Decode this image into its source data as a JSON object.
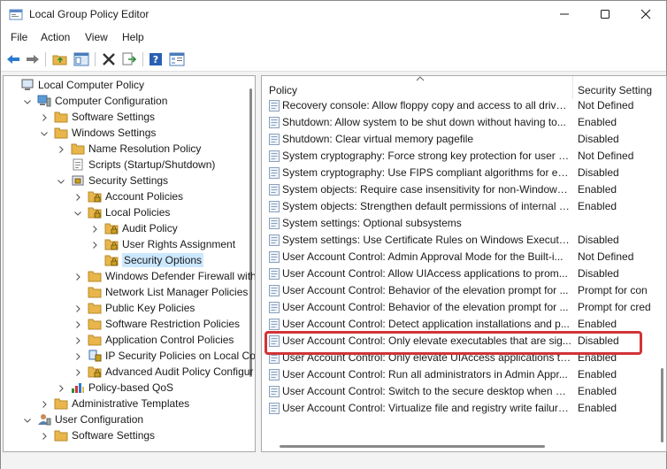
{
  "window": {
    "title": "Local Group Policy Editor"
  },
  "menu": [
    "File",
    "Action",
    "View",
    "Help"
  ],
  "toolbar": {
    "icons": [
      "back-arrow-icon",
      "forward-arrow-icon",
      "up-folder-icon",
      "show-hide-tree-icon",
      "delete-icon",
      "export-list-icon",
      "help-icon",
      "properties-icon"
    ]
  },
  "tree": [
    {
      "label": "Local Computer Policy",
      "indent": 0,
      "chevron": "",
      "icon": "computer-icon"
    },
    {
      "label": "Computer Configuration",
      "indent": 1,
      "chevron": "down",
      "icon": "computer-config-icon"
    },
    {
      "label": "Software Settings",
      "indent": 2,
      "chevron": "right",
      "icon": "folder-icon"
    },
    {
      "label": "Windows Settings",
      "indent": 2,
      "chevron": "down",
      "icon": "folder-icon"
    },
    {
      "label": "Name Resolution Policy",
      "indent": 3,
      "chevron": "right",
      "icon": "folder-icon"
    },
    {
      "label": "Scripts (Startup/Shutdown)",
      "indent": 3,
      "chevron": "",
      "icon": "script-icon"
    },
    {
      "label": "Security Settings",
      "indent": 3,
      "chevron": "down",
      "icon": "security-icon"
    },
    {
      "label": "Account Policies",
      "indent": 4,
      "chevron": "right",
      "icon": "folder-lock-icon"
    },
    {
      "label": "Local Policies",
      "indent": 4,
      "chevron": "down",
      "icon": "folder-lock-icon"
    },
    {
      "label": "Audit Policy",
      "indent": 5,
      "chevron": "right",
      "icon": "folder-lock-icon"
    },
    {
      "label": "User Rights Assignment",
      "indent": 5,
      "chevron": "right",
      "icon": "folder-lock-icon"
    },
    {
      "label": "Security Options",
      "indent": 5,
      "chevron": "",
      "icon": "folder-lock-icon",
      "selected": true
    },
    {
      "label": "Windows Defender Firewall with",
      "indent": 4,
      "chevron": "right",
      "icon": "folder-icon"
    },
    {
      "label": "Network List Manager Policies",
      "indent": 4,
      "chevron": "",
      "icon": "folder-icon"
    },
    {
      "label": "Public Key Policies",
      "indent": 4,
      "chevron": "right",
      "icon": "folder-icon"
    },
    {
      "label": "Software Restriction Policies",
      "indent": 4,
      "chevron": "right",
      "icon": "folder-icon"
    },
    {
      "label": "Application Control Policies",
      "indent": 4,
      "chevron": "right",
      "icon": "folder-icon"
    },
    {
      "label": "IP Security Policies on Local Cor",
      "indent": 4,
      "chevron": "right",
      "icon": "ip-security-icon"
    },
    {
      "label": "Advanced Audit Policy Configur",
      "indent": 4,
      "chevron": "right",
      "icon": "folder-lock-icon"
    },
    {
      "label": "Policy-based QoS",
      "indent": 3,
      "chevron": "right",
      "icon": "qos-chart-icon"
    },
    {
      "label": "Administrative Templates",
      "indent": 2,
      "chevron": "right",
      "icon": "folder-icon"
    },
    {
      "label": "User Configuration",
      "indent": 1,
      "chevron": "down",
      "icon": "user-config-icon"
    },
    {
      "label": "Software Settings",
      "indent": 2,
      "chevron": "right",
      "icon": "folder-icon"
    }
  ],
  "list": {
    "columns": {
      "policy": "Policy",
      "setting": "Security Setting"
    },
    "rows": [
      {
        "policy": "Recovery console: Allow floppy copy and access to all drives...",
        "setting": "Not Defined"
      },
      {
        "policy": "Shutdown: Allow system to be shut down without having to...",
        "setting": "Enabled"
      },
      {
        "policy": "Shutdown: Clear virtual memory pagefile",
        "setting": "Disabled"
      },
      {
        "policy": "System cryptography: Force strong key protection for user k...",
        "setting": "Not Defined"
      },
      {
        "policy": "System cryptography: Use FIPS compliant algorithms for en...",
        "setting": "Disabled"
      },
      {
        "policy": "System objects: Require case insensitivity for non-Windows ...",
        "setting": "Enabled"
      },
      {
        "policy": "System objects: Strengthen default permissions of internal s...",
        "setting": "Enabled"
      },
      {
        "policy": "System settings: Optional subsystems",
        "setting": ""
      },
      {
        "policy": "System settings: Use Certificate Rules on Windows Executab...",
        "setting": "Disabled"
      },
      {
        "policy": "User Account Control: Admin Approval Mode for the Built-i...",
        "setting": "Not Defined"
      },
      {
        "policy": "User Account Control: Allow UIAccess applications to prom...",
        "setting": "Disabled"
      },
      {
        "policy": "User Account Control: Behavior of the elevation prompt for ...",
        "setting": "Prompt for con"
      },
      {
        "policy": "User Account Control: Behavior of the elevation prompt for ...",
        "setting": "Prompt for cred"
      },
      {
        "policy": "User Account Control: Detect application installations and p...",
        "setting": "Enabled"
      },
      {
        "policy": "User Account Control: Only elevate executables that are sig...",
        "setting": "Disabled",
        "highlighted": true
      },
      {
        "policy": "User Account Control: Only elevate UIAccess applications th...",
        "setting": "Enabled"
      },
      {
        "policy": "User Account Control: Run all administrators in Admin Appr...",
        "setting": "Enabled"
      },
      {
        "policy": "User Account Control: Switch to the secure desktop when pr...",
        "setting": "Enabled"
      },
      {
        "policy": "User Account Control: Virtualize file and registry write failure...",
        "setting": "Enabled"
      }
    ]
  },
  "colors": {
    "selection": "#cce8ff",
    "highlight_border": "#d13438",
    "folder": "#e8b64a"
  }
}
